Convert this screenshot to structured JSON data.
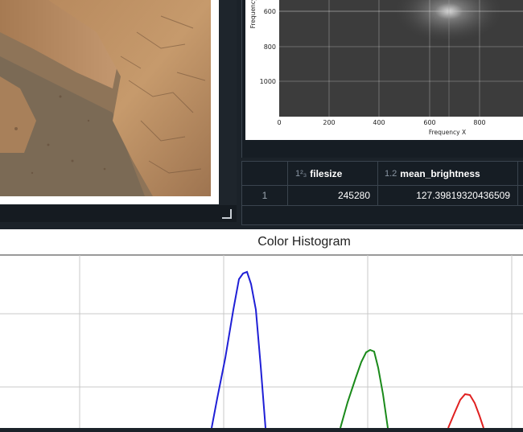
{
  "fft_plot": {
    "y_axis_label": "Frequency",
    "x_axis_label": "Frequency X",
    "y_ticks": [
      "600",
      "800",
      "1000"
    ],
    "x_ticks": [
      "0",
      "200",
      "400",
      "600",
      "800"
    ]
  },
  "table": {
    "columns": [
      {
        "type_icon": "1²₃",
        "name": "filesize"
      },
      {
        "type_icon": "1.2",
        "name": "mean_brightness"
      }
    ],
    "rows": [
      {
        "index": "1",
        "filesize": "245280",
        "mean_brightness": "127.39819320436509"
      }
    ]
  },
  "histogram": {
    "title": "Color Histogram",
    "colors": {
      "blue": "#1f1fd6",
      "green": "#1a8a1a",
      "red": "#e02020"
    }
  },
  "icons": {
    "resize": "resize-handle-icon",
    "integer_type": "integer-type-icon",
    "decimal_type": "decimal-type-icon"
  }
}
